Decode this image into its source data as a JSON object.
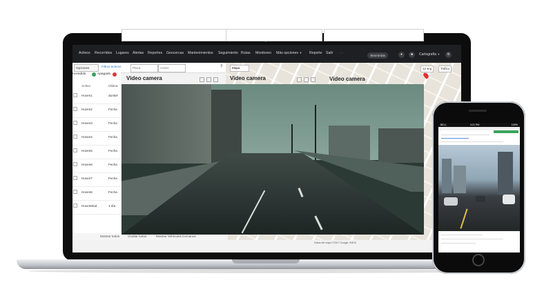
{
  "nav": {
    "items": [
      "Activos",
      "Recorridos",
      "Lugares",
      "Alertas",
      "Reportes",
      "Geocercas",
      "Mantenimientos",
      "Seguimiento",
      "Rutas",
      "Monitoreo",
      "Más opciones",
      "Reporte",
      "Salir"
    ],
    "action_button": "Sincroniza",
    "cartography": "Cartografía"
  },
  "toolbar": {
    "options_label": "Opciones",
    "filter_label": "Filtrar activos",
    "search_placeholder": "Placa",
    "active_placeholder": "Activo"
  },
  "tracking": {
    "label": "ncendido",
    "off_label": "Apagado"
  },
  "table": {
    "headers": [
      "Activo",
      "Última"
    ],
    "rows": [
      {
        "name": "Hoven1",
        "date": "dunkel"
      },
      {
        "name": "Hoven2",
        "date": "Fecha"
      },
      {
        "name": "Hoven3",
        "date": "Fecha"
      },
      {
        "name": "Hoven4",
        "date": "Fecha"
      },
      {
        "name": "Hoven5",
        "date": "Fecha"
      },
      {
        "name": "Hoven6",
        "date": "Fecha"
      },
      {
        "name": "Hoven7",
        "date": "Fecha"
      },
      {
        "name": "Hoven8",
        "date": "Fecha"
      },
      {
        "name": "HovenMod",
        "date": "1 día"
      }
    ]
  },
  "bottom_bar": [
    "Mostrar todos",
    "Ocultar todos",
    "Mostrar Vehículos Cercanos"
  ],
  "map": {
    "type_label": "Mapa",
    "buttons": [
      "12 seg",
      "Tráfico"
    ],
    "attribution": "Datos del mapa ©2017 Google, INEGI"
  },
  "panels": [
    {
      "title": "Video camera"
    },
    {
      "title": "Video camera"
    },
    {
      "title": "Video camera"
    }
  ],
  "phone": {
    "status_left": "BELL",
    "status_time": "4:21 PM",
    "status_right": "100%"
  },
  "colors": {
    "nav_bg": "#1d1f22",
    "status_on": "#3aa35c",
    "status_off": "#d63a3a",
    "link": "#3a73c9"
  }
}
